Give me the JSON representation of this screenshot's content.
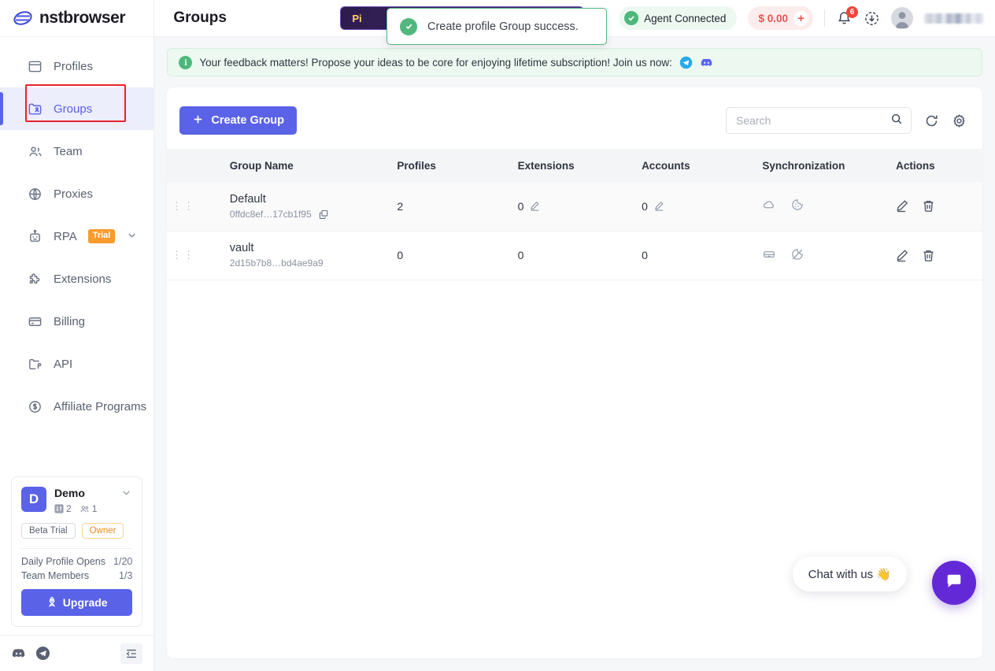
{
  "brand": {
    "name": "nstbrowser",
    "logo_icon": "nstbrowser-logo-icon"
  },
  "sidebar": {
    "items": [
      {
        "label": "Profiles",
        "icon": "browser-window-icon",
        "active": false
      },
      {
        "label": "Groups",
        "icon": "folder-user-icon",
        "active": true
      },
      {
        "label": "Team",
        "icon": "people-icon",
        "active": false
      },
      {
        "label": "Proxies",
        "icon": "globe-icon",
        "active": false
      },
      {
        "label": "RPA",
        "icon": "robot-icon",
        "active": false,
        "badge": "Trial",
        "chevron": "chevron-down-icon"
      },
      {
        "label": "Extensions",
        "icon": "puzzle-icon",
        "active": false
      },
      {
        "label": "Billing",
        "icon": "credit-card-icon",
        "active": false
      },
      {
        "label": "API",
        "icon": "api-folder-icon",
        "active": false
      },
      {
        "label": "Affiliate Programs",
        "icon": "dollar-circle-icon",
        "active": false
      }
    ],
    "plan_card": {
      "avatar_letter": "D",
      "workspace_name": "Demo",
      "profiles_count": "2",
      "members_count": "1",
      "tags": [
        "Beta Trial",
        "Owner"
      ],
      "rows": [
        {
          "label": "Daily Profile Opens",
          "value": "1/20"
        },
        {
          "label": "Team Members",
          "value": "1/3"
        }
      ],
      "upgrade_label": "Upgrade",
      "upgrade_icon": "rocket-icon",
      "expand_icon": "chevron-down-icon"
    },
    "footer": {
      "discord_icon": "discord-icon",
      "telegram_icon": "telegram-icon",
      "collapse_icon": "collapse-sidebar-icon"
    }
  },
  "header": {
    "title": "Groups",
    "promo_label": "Pi",
    "agent_status": "Agent Connected",
    "balance": "$ 0.00",
    "add_funds_icon": "plus-icon",
    "notifications_count": "6",
    "bell_icon": "bell-icon",
    "download_icon": "download-circle-icon",
    "avatar_icon": "user-avatar-icon",
    "username": ""
  },
  "banner": {
    "icon": "info-icon",
    "text": "Your feedback matters! Propose your ideas to be core for enjoying lifetime subscription! Join us now:",
    "telegram_icon": "telegram-icon",
    "discord_icon": "discord-icon"
  },
  "toolbar": {
    "create_label": "Create Group",
    "create_icon": "plus-icon",
    "search_placeholder": "Search",
    "search_value": "",
    "search_icon": "search-icon",
    "refresh_icon": "refresh-icon",
    "settings_icon": "gear-icon"
  },
  "table": {
    "columns": [
      "Group Name",
      "Profiles",
      "Extensions",
      "Accounts",
      "Synchronization",
      "Actions"
    ],
    "rows": [
      {
        "name": "Default",
        "id": "0ffdc8ef…17cb1f95",
        "profiles": "2",
        "extensions": "0",
        "accounts": "0",
        "sync_icons": [
          "cloud-icon",
          "cookie-icon"
        ],
        "actions": [
          "edit-icon",
          "delete-icon"
        ]
      },
      {
        "name": "vault",
        "id": "2d15b7b8…bd4ae9a9",
        "profiles": "0",
        "extensions": "0",
        "accounts": "0",
        "sync_icons": [
          "drawer-icon",
          "cookie-disabled-icon"
        ],
        "actions": [
          "edit-icon",
          "delete-icon"
        ]
      }
    ]
  },
  "toast": {
    "message": "Create profile Group success.",
    "icon": "check-circle-icon"
  },
  "chat": {
    "label": "Chat with us 👋",
    "fab_icon": "chat-bubble-icon"
  },
  "colors": {
    "accent": "#5a62e8",
    "success": "#4cb87a",
    "danger": "#ef5350",
    "trial": "#fa9b2e",
    "chat": "#6429d6",
    "highlight": "#e8232a"
  }
}
